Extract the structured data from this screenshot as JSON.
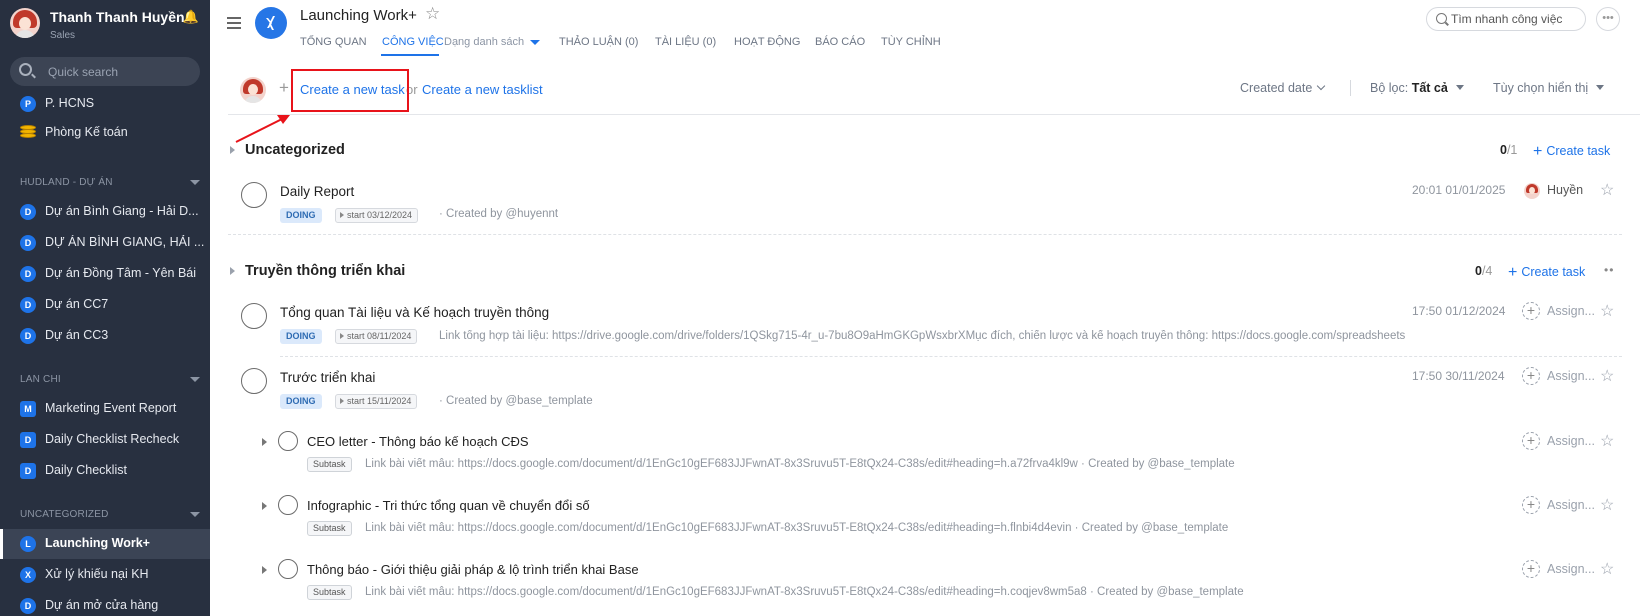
{
  "user": {
    "name": "Thanh Thanh Huyền",
    "role": "Sales"
  },
  "sidebar": {
    "search_placeholder": "Quick search",
    "top_items": [
      {
        "badge": "P",
        "label": "P. HCNS"
      },
      {
        "icon": "coins-icon",
        "label": "Phòng Kế toán"
      }
    ],
    "sections": [
      {
        "title": "HUDLAND - DỰ ÁN",
        "items": [
          {
            "badge": "D",
            "label": "Dự án Bình Giang - Hải D..."
          },
          {
            "badge": "D",
            "label": "DỰ ÁN BÌNH GIANG, HẢI ..."
          },
          {
            "badge": "D",
            "label": "Dự án Đồng Tâm - Yên Bái"
          },
          {
            "badge": "D",
            "label": "Dự án CC7"
          },
          {
            "badge": "D",
            "label": "Dự án CC3"
          }
        ]
      },
      {
        "title": "LAN CHI",
        "items": [
          {
            "badge": "M",
            "label": "Marketing Event Report"
          },
          {
            "badge": "D",
            "label": "Daily Checklist Recheck"
          },
          {
            "badge": "D",
            "label": "Daily Checklist"
          }
        ]
      },
      {
        "title": "UNCATEGORIZED",
        "items": [
          {
            "badge": "L",
            "label": "Launching Work+"
          },
          {
            "badge": "X",
            "label": "Xử lý khiếu nại KH"
          },
          {
            "badge": "D",
            "label": "Dự án mở cửa hàng"
          }
        ]
      }
    ]
  },
  "header": {
    "project_title": "Launching Work+",
    "tabs": [
      "TỔNG QUAN",
      "CÔNG VIỆC",
      "THẢO LUẬN (0)",
      "TÀI LIỆU (0)",
      "HOẠT ĐỘNG",
      "BÁO CÁO",
      "TÙY CHỈNH"
    ],
    "active_tab_sub": "Dạng danh sách",
    "search_placeholder": "Tìm nhanh công việc",
    "more": "•••"
  },
  "toolbar": {
    "create_task": "Create a new task",
    "or": "or",
    "create_tasklist": "Create a new tasklist",
    "sort": "Created date",
    "filter_label": "Bộ lọc:",
    "filter_value": "Tất cả",
    "display_options": "Tùy chọn hiển thị"
  },
  "colors": {
    "accent": "#1e73e8",
    "sidebar_bg": "#283040",
    "highlight": "#e8131a",
    "doing_bg": "#dbe9fb"
  },
  "groups": [
    {
      "title": "Uncategorized",
      "count_done": "0",
      "count_total": "/1",
      "create_label": "Create task",
      "tasks": [
        {
          "title": "Daily Report",
          "status": "DOING",
          "start": "start 03/12/2024",
          "desc": "· Created by @huyennt",
          "time": "20:01 01/01/2025",
          "assignee": "Huyền"
        }
      ]
    },
    {
      "title": "Truyền thông triển khai",
      "count_done": "0",
      "count_total": "/4",
      "create_label": "Create task",
      "tasks": [
        {
          "title": "Tổng quan Tài liệu và Kế hoạch truyền thông",
          "status": "DOING",
          "start": "start 08/11/2024",
          "desc": "Link tổng hợp tài liệu: https://drive.google.com/drive/folders/1QSkg715-4r_u-7bu8O9aHmGKGpWsxbrXMục đích, chiến lược và kế hoạch truyền thông: https://docs.google.com/spreadsheets",
          "time": "17:50 01/12/2024",
          "assignee": "Assign..."
        },
        {
          "title": "Trước triển khai",
          "status": "DOING",
          "start": "start 15/11/2024",
          "desc": "· Created by @base_template",
          "time": "17:50 30/11/2024",
          "assignee": "Assign..."
        }
      ],
      "subtasks": [
        {
          "title": "CEO letter - Thông báo kế hoạch CĐS",
          "chip": "Subtask",
          "desc": "Link bài viết mẫu: https://docs.google.com/document/d/1EnGc10gEF683JJFwnAT-8x3Sruvu5T-E8tQx24-C38s/edit#heading=h.a72frva4kl9w · Created by @base_template",
          "assignee": "Assign..."
        },
        {
          "title": "Infographic - Tri thức tổng quan về chuyển đổi số",
          "chip": "Subtask",
          "desc": "Link bài viết mẫu: https://docs.google.com/document/d/1EnGc10gEF683JJFwnAT-8x3Sruvu5T-E8tQx24-C38s/edit#heading=h.flnbi4d4evin · Created by @base_template",
          "assignee": "Assign..."
        },
        {
          "title": "Thông báo - Giới thiệu giải pháp & lộ trình triển khai Base",
          "chip": "Subtask",
          "desc": "Link bài viết mẫu: https://docs.google.com/document/d/1EnGc10gEF683JJFwnAT-8x3Sruvu5T-E8tQx24-C38s/edit#heading=h.coqjev8wm5a8 · Created by @base_template",
          "assignee": "Assign..."
        }
      ]
    }
  ]
}
